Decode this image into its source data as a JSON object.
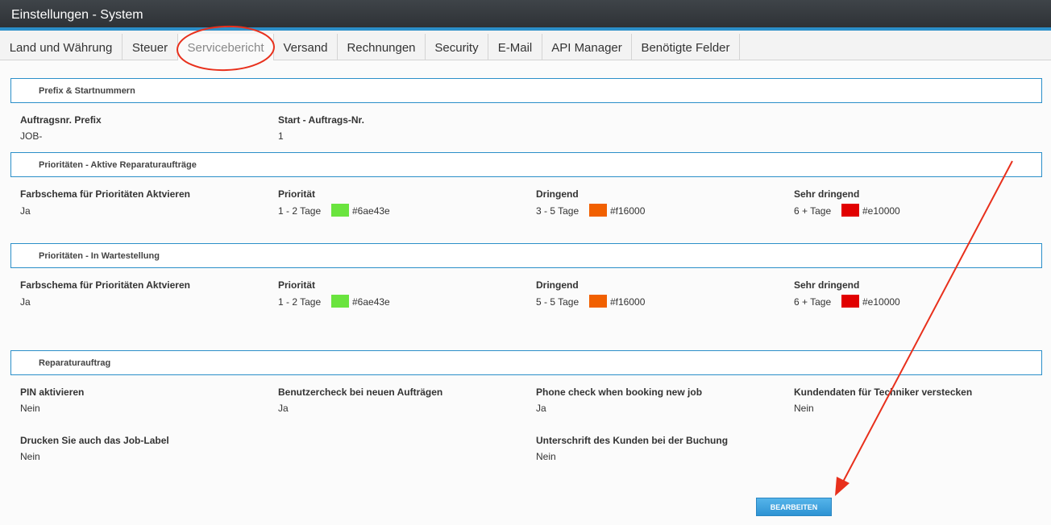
{
  "window": {
    "title": "Einstellungen - System"
  },
  "tabs": [
    {
      "label": "Land und Währung"
    },
    {
      "label": "Steuer"
    },
    {
      "label": "Servicebericht"
    },
    {
      "label": "Versand"
    },
    {
      "label": "Rechnungen"
    },
    {
      "label": "Security"
    },
    {
      "label": "E-Mail"
    },
    {
      "label": "API Manager"
    },
    {
      "label": "Benötigte Felder"
    }
  ],
  "active_tab": "Servicebericht",
  "prefix_section": {
    "header": "Prefix & Startnummern",
    "prefix_label": "Auftragsnr. Prefix",
    "prefix_value": "JOB-",
    "start_label": "Start - Auftrags-Nr.",
    "start_value": "1"
  },
  "active_priorities": {
    "header": "Prioritäten - Aktive Reparaturaufträge",
    "scheme_label": "Farbschema für Prioritäten Aktvieren",
    "scheme_value": "Ja",
    "normal": {
      "label": "Priorität",
      "days": "1 - 2 Tage",
      "color": "#6ae43e",
      "color_text": "#6ae43e"
    },
    "urgent": {
      "label": "Dringend",
      "days": "3 - 5 Tage",
      "color": "#f16000",
      "color_text": "#f16000"
    },
    "very_urgent": {
      "label": "Sehr dringend",
      "days": "6 + Tage",
      "color": "#e10000",
      "color_text": "#e10000"
    }
  },
  "waiting_priorities": {
    "header": "Prioritäten - In Wartestellung",
    "scheme_label": "Farbschema für Prioritäten Aktvieren",
    "scheme_value": "Ja",
    "normal": {
      "label": "Priorität",
      "days": "1 - 2 Tage",
      "color": "#6ae43e",
      "color_text": "#6ae43e"
    },
    "urgent": {
      "label": "Dringend",
      "days": "5 - 5 Tage",
      "color": "#f16000",
      "color_text": "#f16000"
    },
    "very_urgent": {
      "label": "Sehr dringend",
      "days": "6 + Tage",
      "color": "#e10000",
      "color_text": "#e10000"
    }
  },
  "repair_order": {
    "header": "Reparaturauftrag",
    "pin_label": "PIN aktivieren",
    "pin_value": "Nein",
    "usercheck_label": "Benutzercheck bei neuen Aufträgen",
    "usercheck_value": "Ja",
    "phonecheck_label": "Phone check when booking new job",
    "phonecheck_value": "Ja",
    "hide_customer_label": "Kundendaten für Techniker verstecken",
    "hide_customer_value": "Nein",
    "print_label_label": "Drucken Sie auch das Job-Label",
    "print_label_value": "Nein",
    "signature_label": "Unterschrift des Kunden bei der Buchung",
    "signature_value": "Nein"
  },
  "edit_button": {
    "label": "BEARBEITEN"
  },
  "colors": {
    "accent": "#2b8fc9",
    "annotation": "#e8301c"
  }
}
